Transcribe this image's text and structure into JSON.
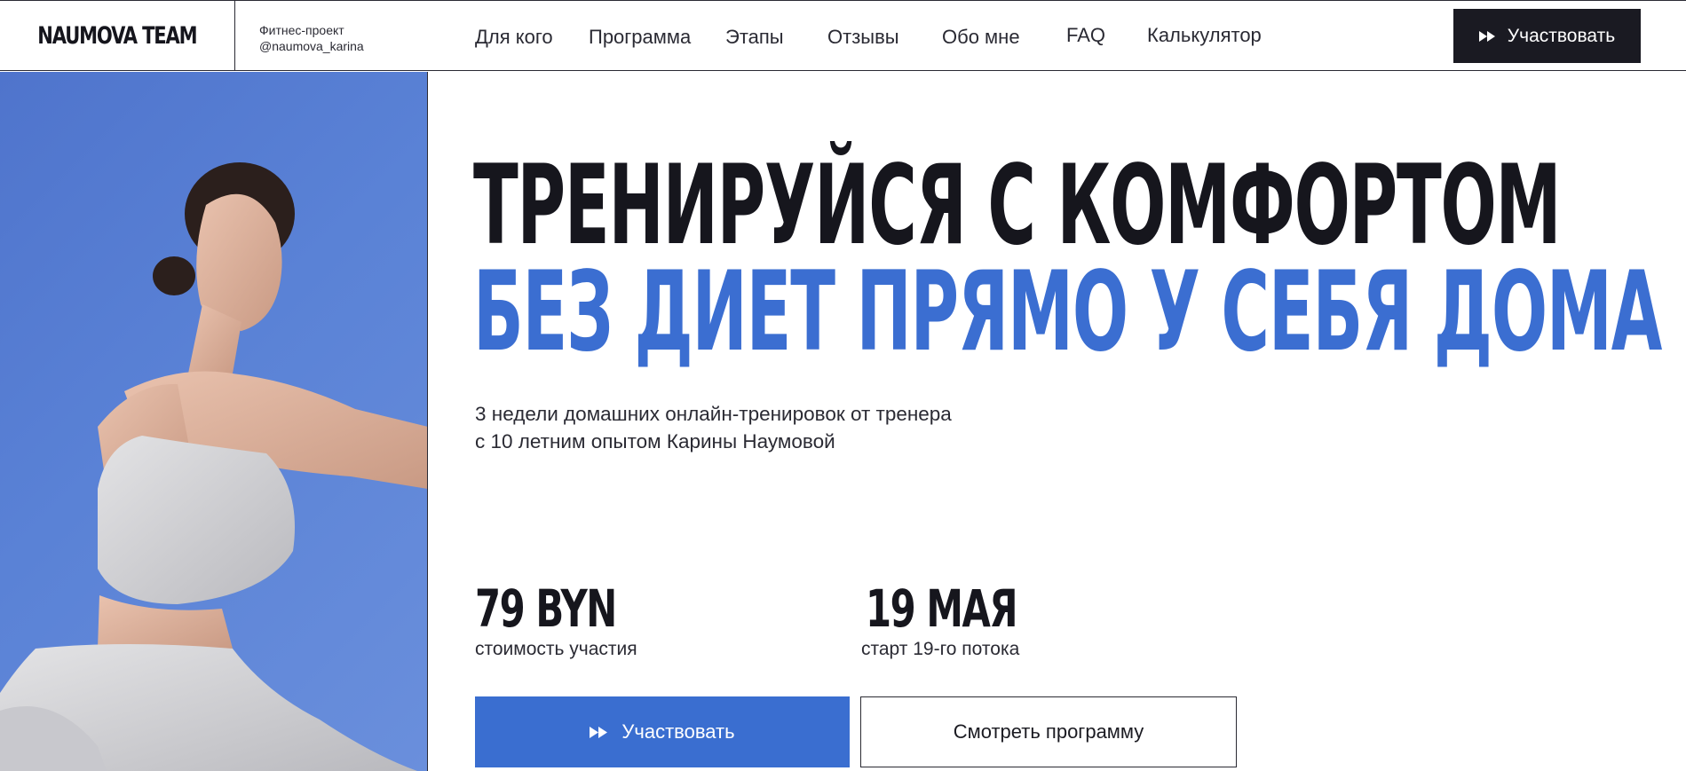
{
  "header": {
    "logo": "NAUMOVA TEAM",
    "project_line1": "Фитнес-проект",
    "project_line2": "@naumova_karina",
    "nav": [
      {
        "label": "Для кого"
      },
      {
        "label": "Программа"
      },
      {
        "label": "Этапы"
      },
      {
        "label": "Отзывы"
      },
      {
        "label": "Обо мне"
      },
      {
        "label": "FAQ"
      },
      {
        "label": "Калькулятор"
      }
    ],
    "cta_label": "Участвовать",
    "cta_icon": "fast-forward-icon"
  },
  "hero": {
    "headline_line1": "ТРЕНИРУЙСЯ С КОМФОРТОМ",
    "headline_line2": "БЕЗ ДИЕТ ПРЯМО У СЕБЯ ДОМА",
    "subtitle_line1": "3 недели домашних онлайн-тренировок от тренера",
    "subtitle_line2": "с 10 летним опытом Карины Наумовой",
    "stats": [
      {
        "value": "79 BYN",
        "label": "стоимость участия"
      },
      {
        "value": "19 МАЯ",
        "label": "старт 19-го потока"
      }
    ],
    "primary_button": "Участвовать",
    "secondary_button": "Смотреть программу"
  },
  "colors": {
    "accent_blue": "#3a6ed0",
    "dark": "#1a1a22",
    "photo_background": "#5a82d6"
  }
}
